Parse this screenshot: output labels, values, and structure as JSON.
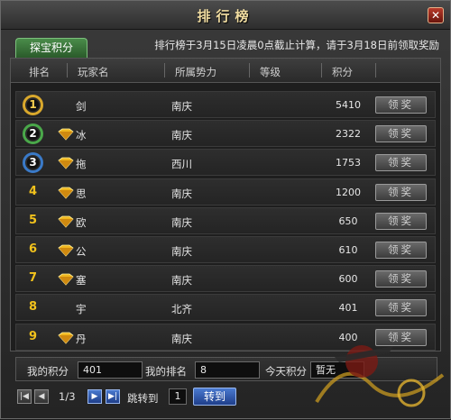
{
  "window": {
    "title": "排行榜",
    "close_glyph": "✕"
  },
  "tab": {
    "label": "探宝积分"
  },
  "notice": "排行榜于3月15日凌晨0点截止计算，请于3月18日前领取奖励",
  "table": {
    "headers": [
      "排名",
      "玩家名",
      "所属势力",
      "等级",
      "积分"
    ],
    "claim_label": "领奖",
    "rows": [
      {
        "rank": "1",
        "medal": "gold",
        "vip": false,
        "player": "剑",
        "faction": "南庆",
        "level": "",
        "score": "5410"
      },
      {
        "rank": "2",
        "medal": "green",
        "vip": true,
        "player": "冰",
        "faction": "南庆",
        "level": "",
        "score": "2322"
      },
      {
        "rank": "3",
        "medal": "blue",
        "vip": true,
        "player": "拖",
        "faction": "西川",
        "level": "",
        "score": "1753"
      },
      {
        "rank": "4",
        "medal": "",
        "vip": true,
        "player": "思",
        "faction": "南庆",
        "level": "",
        "score": "1200"
      },
      {
        "rank": "5",
        "medal": "",
        "vip": true,
        "player": "欧",
        "faction": "南庆",
        "level": "",
        "score": "650"
      },
      {
        "rank": "6",
        "medal": "",
        "vip": true,
        "player": "公",
        "faction": "南庆",
        "level": "",
        "score": "610"
      },
      {
        "rank": "7",
        "medal": "",
        "vip": true,
        "player": "塞",
        "faction": "南庆",
        "level": "",
        "score": "600"
      },
      {
        "rank": "8",
        "medal": "",
        "vip": false,
        "player": "宇",
        "faction": "北齐",
        "level": "",
        "score": "401"
      },
      {
        "rank": "9",
        "medal": "",
        "vip": true,
        "player": "丹",
        "faction": "南庆",
        "level": "",
        "score": "400"
      }
    ]
  },
  "my_stats": {
    "score_label": "我的积分",
    "score_value": "401",
    "rank_label": "我的排名",
    "rank_value": "8",
    "today_label": "今天积分",
    "today_value": "暂无"
  },
  "pager": {
    "first_glyph": "|◀",
    "prev_glyph": "◀",
    "next_glyph": "▶",
    "last_glyph": "▶|",
    "page_text": "1/3",
    "goto_label": "跳转到",
    "goto_value": "1",
    "goto_button": "转到"
  },
  "icons": {
    "vip": "gold-diamond-vip-icon",
    "close": "close-icon"
  },
  "colors": {
    "rank_gold": "#f2c21c",
    "tab_green": "#4a8c4a",
    "button_blue": "#2a5ab0"
  }
}
